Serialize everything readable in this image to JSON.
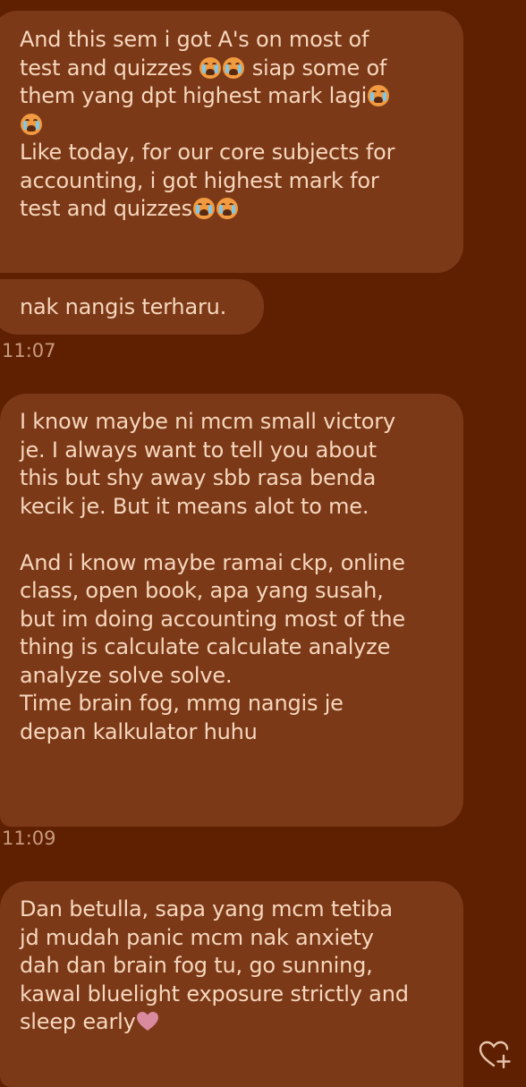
{
  "messages": [
    {
      "segments": [
        {
          "text": "And this sem i got A's on most of\ntest and quizzes "
        },
        {
          "emoji": "loudly-crying-face"
        },
        {
          "emoji": "loudly-crying-face"
        },
        {
          "text": " siap some of\nthem yang dpt highest mark lagi"
        },
        {
          "emoji": "loudly-crying-face"
        },
        {
          "text": "\n"
        },
        {
          "emoji": "loudly-crying-face"
        },
        {
          "text": "\nLike today, for our core subjects for\naccounting, i got highest mark for\ntest and quizzes"
        },
        {
          "emoji": "loudly-crying-face"
        },
        {
          "emoji": "loudly-crying-face"
        }
      ]
    },
    {
      "text": "nak nangis terharu."
    },
    {
      "time": "11:07"
    },
    {
      "text": "I know maybe ni mcm small victory\nje. I always want to tell you about\nthis but shy away sbb rasa benda\nkecik je. But it means alot to me.\n\nAnd i know maybe ramai ckp, online\nclass, open book, apa yang susah,\nbut im doing accounting most of the\nthing is calculate calculate analyze\nanalyze solve solve.\nTime brain fog, mmg nangis je\ndepan kalkulator huhu"
    },
    {
      "time": "11:09"
    },
    {
      "segments": [
        {
          "text": "Dan betulla, sapa yang mcm tetiba\njd mudah panic mcm nak anxiety\ndah dan brain fog tu, go sunning,\nkawal bluelight exposure strictly and\nsleep early"
        },
        {
          "emoji": "pink-heart"
        }
      ]
    }
  ],
  "b1": {
    "s1": "And this sem i got A's on most of\ntest and quizzes ",
    "s2": " siap some of\nthem yang dpt highest mark lagi",
    "s3": "\n",
    "s4": "\nLike today, for our core subjects for\naccounting, i got highest mark for\ntest and quizzes"
  },
  "b2": {
    "text": "nak nangis terharu."
  },
  "t1": "11:07",
  "b3": {
    "text": "I know maybe ni mcm small victory\nje. I always want to tell you about\nthis but shy away sbb rasa benda\nkecik je. But it means alot to me.\n\nAnd i know maybe ramai ckp, online\nclass, open book, apa yang susah,\nbut im doing accounting most of the\nthing is calculate calculate analyze\nanalyze solve solve.\nTime brain fog, mmg nangis je\ndepan kalkulator huhu"
  },
  "t2": "11:09",
  "b4": {
    "s1": "Dan betulla, sapa yang mcm tetiba\njd mudah panic mcm nak anxiety\ndah dan brain fog tu, go sunning,\nkawal bluelight exposure strictly and\nsleep early"
  },
  "icons": {
    "emoji": "loudly-crying-face",
    "heart": "pink-heart",
    "like": "heart-plus-icon"
  },
  "colors": {
    "background": "#5e2000",
    "bubble": "#7b3918",
    "text": "#f7d7bd",
    "timestamp": "#c99a7f",
    "heart": "#d98a9f"
  }
}
